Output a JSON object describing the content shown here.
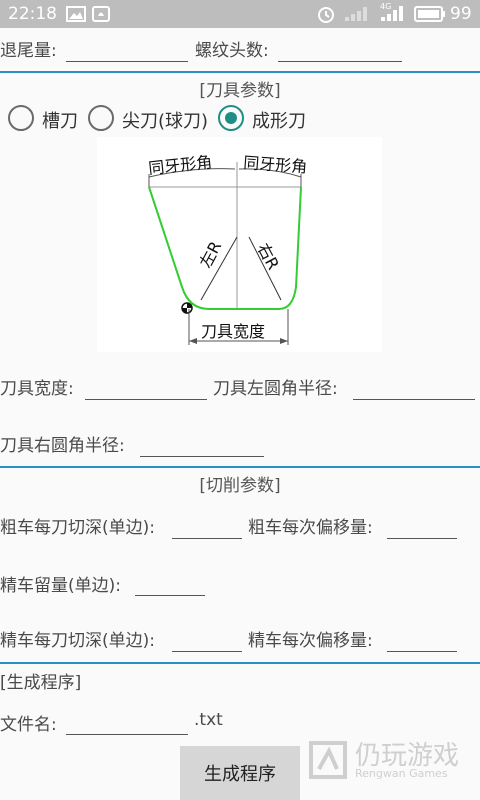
{
  "status_bar": {
    "time": "22:18",
    "network": "4G",
    "battery": "99"
  },
  "top_fields": {
    "retract_label": "退尾量:",
    "retract_value": "",
    "thread_starts_label": "螺纹头数:",
    "thread_starts_value": ""
  },
  "tool_section": {
    "title": "[刀具参数]",
    "options": [
      {
        "label": "槽刀",
        "checked": false
      },
      {
        "label": "尖刀(球刀)",
        "checked": false
      },
      {
        "label": "成形刀",
        "checked": true
      }
    ],
    "diagram": {
      "left_angle_label": "同牙形角",
      "right_angle_label": "同牙形角",
      "left_radius_label": "左R",
      "right_radius_label": "右R",
      "width_label": "刀具宽度"
    },
    "tool_width_label": "刀具宽度:",
    "left_radius_label": "刀具左圆角半径:",
    "right_radius_label": "刀具右圆角半径:"
  },
  "cut_section": {
    "title": "[切削参数]",
    "rough_depth_label": "粗车每刀切深(单边):",
    "rough_offset_label": "粗车每次偏移量:",
    "finish_allow_label": "精车留量(单边):",
    "finish_depth_label": "精车每刀切深(单边):",
    "finish_offset_label": "精车每次偏移量:"
  },
  "gen_section": {
    "title": "[生成程序]",
    "filename_label": "文件名:",
    "filename_value": "",
    "extension": ".txt",
    "button_label": "生成程序"
  },
  "watermark": {
    "text": "仍玩游戏",
    "subtext": "Rengwan Games"
  },
  "colors": {
    "divider": "#2a8fc7",
    "radio_checked": "#1f8f83",
    "diagram_curve": "#33cc33"
  }
}
